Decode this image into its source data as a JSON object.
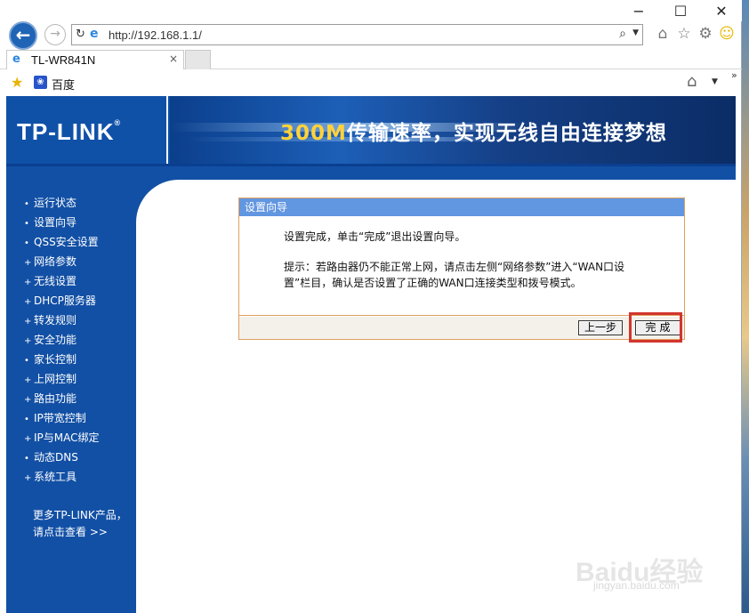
{
  "browser": {
    "window_controls": {
      "minimize": "−",
      "maximize": "☐",
      "close": "✕"
    },
    "address": {
      "url": "http://192.168.1.1/"
    },
    "tab": {
      "title": "TL-WR841N",
      "close": "×"
    },
    "favorites": {
      "item": "百度"
    }
  },
  "banner": {
    "logo": "TP-LINK",
    "logo_mark": "®",
    "slogan_number": "300M",
    "slogan_text": "传输速率，实现无线自由连接梦想"
  },
  "sidebar": {
    "items": [
      {
        "bullet": "•",
        "label": "运行状态"
      },
      {
        "bullet": "•",
        "label": "设置向导"
      },
      {
        "bullet": "•",
        "label": "QSS安全设置"
      },
      {
        "bullet": "+",
        "label": "网络参数"
      },
      {
        "bullet": "+",
        "label": "无线设置"
      },
      {
        "bullet": "+",
        "label": "DHCP服务器"
      },
      {
        "bullet": "+",
        "label": "转发规则"
      },
      {
        "bullet": "+",
        "label": "安全功能"
      },
      {
        "bullet": "•",
        "label": "家长控制"
      },
      {
        "bullet": "+",
        "label": "上网控制"
      },
      {
        "bullet": "+",
        "label": "路由功能"
      },
      {
        "bullet": "•",
        "label": "IP带宽控制"
      },
      {
        "bullet": "+",
        "label": "IP与MAC绑定"
      },
      {
        "bullet": "•",
        "label": "动态DNS"
      },
      {
        "bullet": "+",
        "label": "系统工具"
      }
    ],
    "more_line1": "更多TP-LINK产品，",
    "more_line2": "请点击查看 >>"
  },
  "wizard": {
    "title": "设置向导",
    "message": "设置完成，单击“完成”退出设置向导。",
    "hint": "提示：若路由器仍不能正常上网，请点击左侧“网络参数”进入“WAN口设置”栏目，确认是否设置了正确的WAN口连接类型和拨号模式。",
    "prev_button": "上一步",
    "done_button": "完成"
  },
  "watermark": {
    "text": "Baidu经验",
    "sub": "jingyan.baidu.com"
  },
  "colors": {
    "brand_blue": "#1250a5",
    "wizard_header": "#6196e0",
    "wizard_border": "#e0a060",
    "highlight": "#d2352e",
    "slogan_accent": "#ffd23a"
  }
}
